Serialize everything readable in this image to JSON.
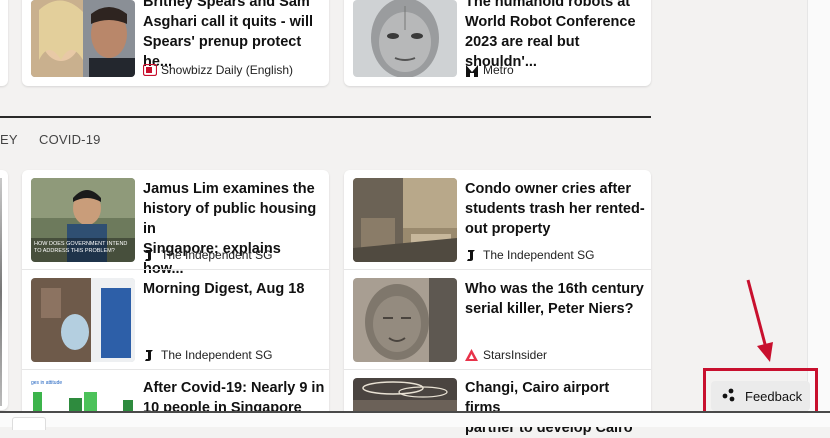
{
  "top_cards": [
    {
      "title": "Britney Spears and Sam\nAsghari call it quits - will\nSpears' prenup protect he...",
      "source": "Showbizz Daily (English)"
    },
    {
      "title": "The humanoid robots at\nWorld Robot Conference\n2023 are real but shouldn'...",
      "source": "Metro"
    }
  ],
  "tabs": [
    {
      "label": "EY"
    },
    {
      "label": "COVID-19"
    }
  ],
  "left_cards": [
    {
      "title": "Jamus Lim examines the\nhistory of public housing in\nSingapore; explains how...",
      "source": "The Independent SG",
      "thumb_caption": "HOW DOES GOVERNMENT INTEND\nTO ADDRESS THIS PROBLEM?"
    },
    {
      "title": "Morning Digest, Aug 18",
      "source": "The Independent SG"
    },
    {
      "title": "After Covid-19: Nearly 9 in\n10 people in Singapore",
      "source": "",
      "thumb_caption": "ges in attitude"
    }
  ],
  "right_cards": [
    {
      "title": "Condo owner cries after\nstudents trash her rented-\nout property",
      "source": "The Independent SG"
    },
    {
      "title": "Who was the 16th century\nserial killer, Peter Niers?",
      "source": "StarsInsider"
    },
    {
      "title": "Changi, Cairo airport firms\npartner to develop Cairo",
      "source": ""
    }
  ],
  "feedback": {
    "label": "Feedback"
  },
  "colors": {
    "accent_red": "#c8102e",
    "stars_red": "#e8334a"
  }
}
